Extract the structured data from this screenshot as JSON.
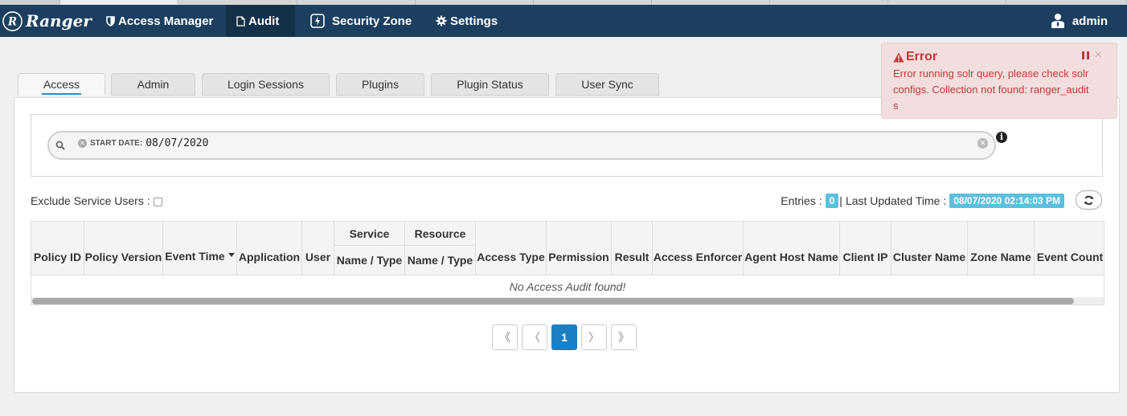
{
  "navbar": {
    "brand": "Ranger",
    "items": [
      {
        "label": "Access Manager",
        "icon": "shield-icon"
      },
      {
        "label": "Audit",
        "icon": "file-icon",
        "active": true
      },
      {
        "label": "Security Zone",
        "icon": "zone-icon"
      },
      {
        "label": "Settings",
        "icon": "gear-icon"
      }
    ],
    "user": "admin"
  },
  "tabs": [
    {
      "label": "Access",
      "active": true
    },
    {
      "label": "Admin"
    },
    {
      "label": "Login Sessions"
    },
    {
      "label": "Plugins"
    },
    {
      "label": "Plugin Status"
    },
    {
      "label": "User Sync"
    }
  ],
  "search": {
    "facet_label": "START DATE:",
    "facet_value": "08/07/2020"
  },
  "filters": {
    "exclude_label": "Exclude Service Users :",
    "entries_label": "Entries :",
    "entries_count": "0",
    "updated_label": "Last Updated Time :",
    "updated_value": "08/07/2020 02:14:03 PM"
  },
  "table": {
    "group_headers": [
      "Service",
      "Resource"
    ],
    "columns": [
      "Policy ID",
      "Policy Version",
      "Event Time",
      "Application",
      "User",
      "Name / Type",
      "Name / Type",
      "Access Type",
      "Permission",
      "Result",
      "Access Enforcer",
      "Agent Host Name",
      "Client IP",
      "Cluster Name",
      "Zone Name",
      "Event Count"
    ],
    "empty_message": "No Access Audit found!"
  },
  "pagination": {
    "first": "《",
    "prev": "〈",
    "current": "1",
    "next": "〉",
    "last": "》"
  },
  "error_toast": {
    "title": "Error",
    "message": "Error running solr query, please check solr configs. Collection not found: ranger_audits",
    "close": "×"
  },
  "colors": {
    "navbar": "#1c3f5f",
    "navbar_active": "#153049",
    "badge": "#5bc0de",
    "page_active": "#1c7fc1",
    "error_bg": "#f2dede",
    "error_text": "#c0393b"
  }
}
